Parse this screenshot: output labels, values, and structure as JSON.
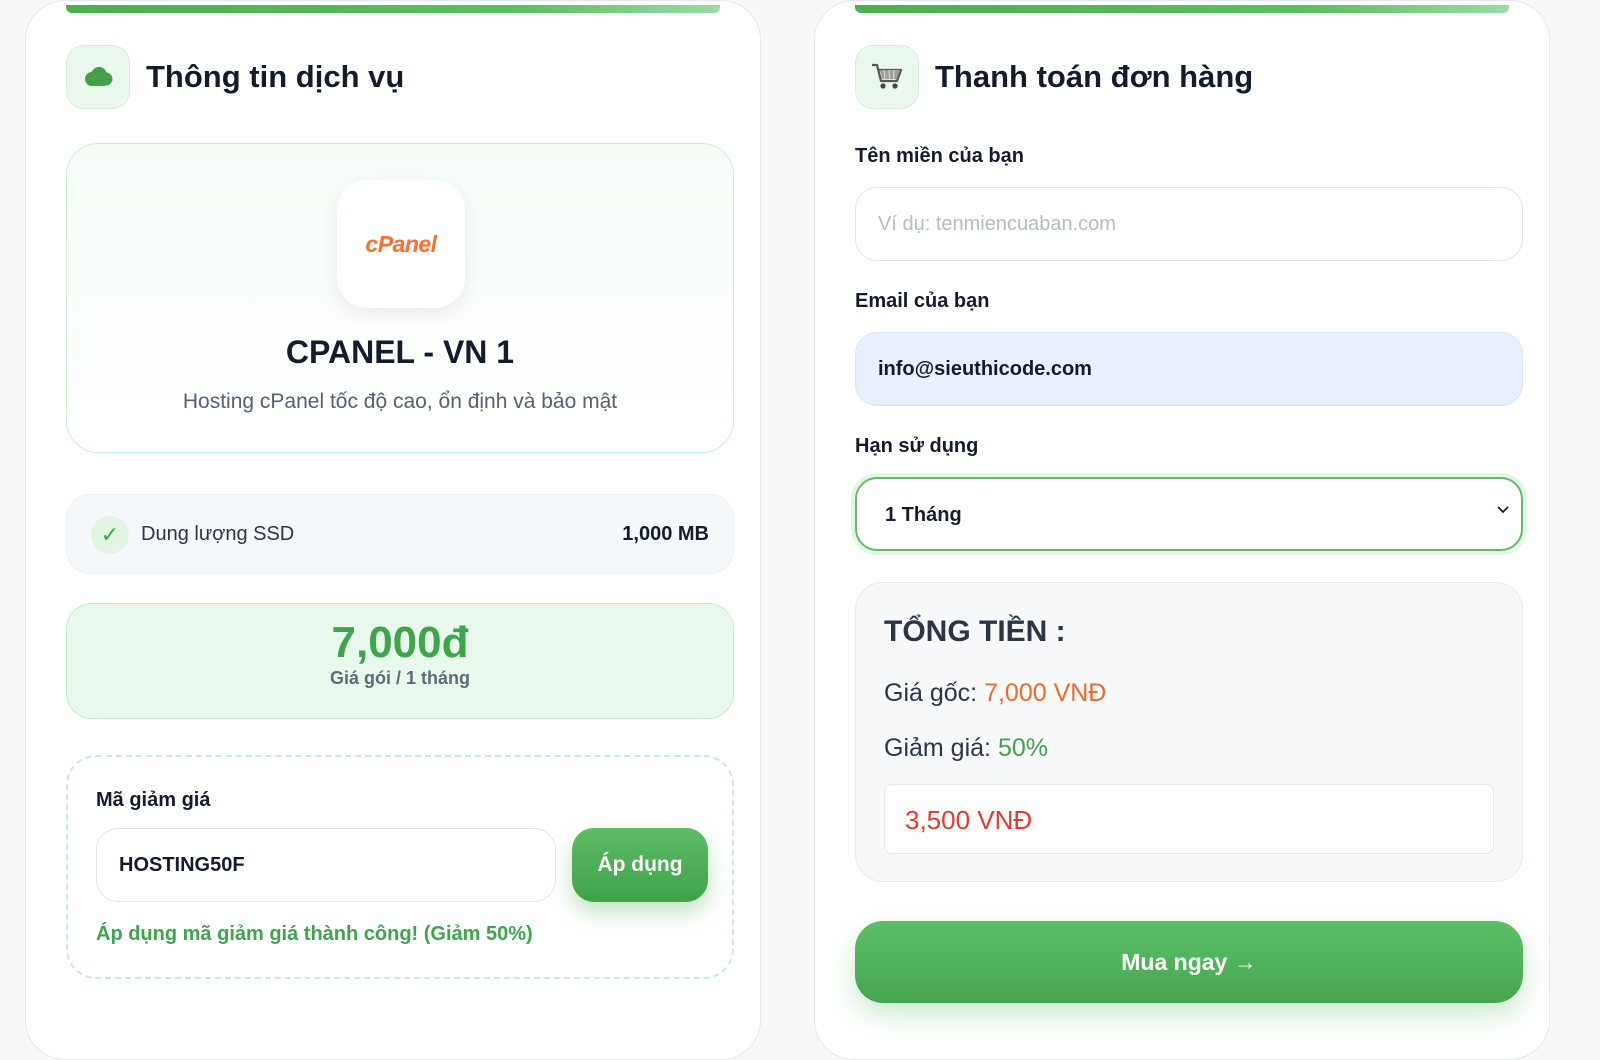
{
  "colors": {
    "accent_green": "#4caf50",
    "price_orange": "#ee6a2c",
    "final_red": "#e53935",
    "cpanel_orange": "#ff6c2c"
  },
  "service_panel": {
    "title": "Thông tin dịch vụ",
    "icon": "cloud-icon",
    "logo_text": "cPanel",
    "service_name": "CPANEL - VN 1",
    "service_desc": "Hosting cPanel tốc độ cao, ổn định và bảo mật",
    "feature": {
      "label": "Dung lượng SSD",
      "value": "1,000 MB",
      "icon": "check-icon"
    },
    "price": {
      "value": "7,000đ",
      "note": "Giá gói / 1 tháng"
    },
    "coupon": {
      "label": "Mã giảm giá",
      "value": "HOSTING50F",
      "button_label": "Áp dụng",
      "success_message": "Áp dụng mã giảm giá thành công! (Giảm 50%)"
    }
  },
  "checkout_panel": {
    "title": "Thanh toán đơn hàng",
    "icon": "cart-icon",
    "domain_field": {
      "label": "Tên miền của bạn",
      "value": "",
      "placeholder": "Ví dụ: tenmiencuaban.com"
    },
    "email_field": {
      "label": "Email của bạn",
      "value": "info@sieuthicode.com"
    },
    "duration_field": {
      "label": "Hạn sử dụng",
      "selected": "1 Tháng"
    },
    "summary": {
      "title": "TỔNG TIỀN :",
      "original_label": "Giá gốc:",
      "original_value": "7,000 VNĐ",
      "discount_label": "Giảm giá:",
      "discount_value": "50%",
      "final_value": "3,500 VNĐ"
    },
    "buy_button_label": "Mua ngay →"
  }
}
